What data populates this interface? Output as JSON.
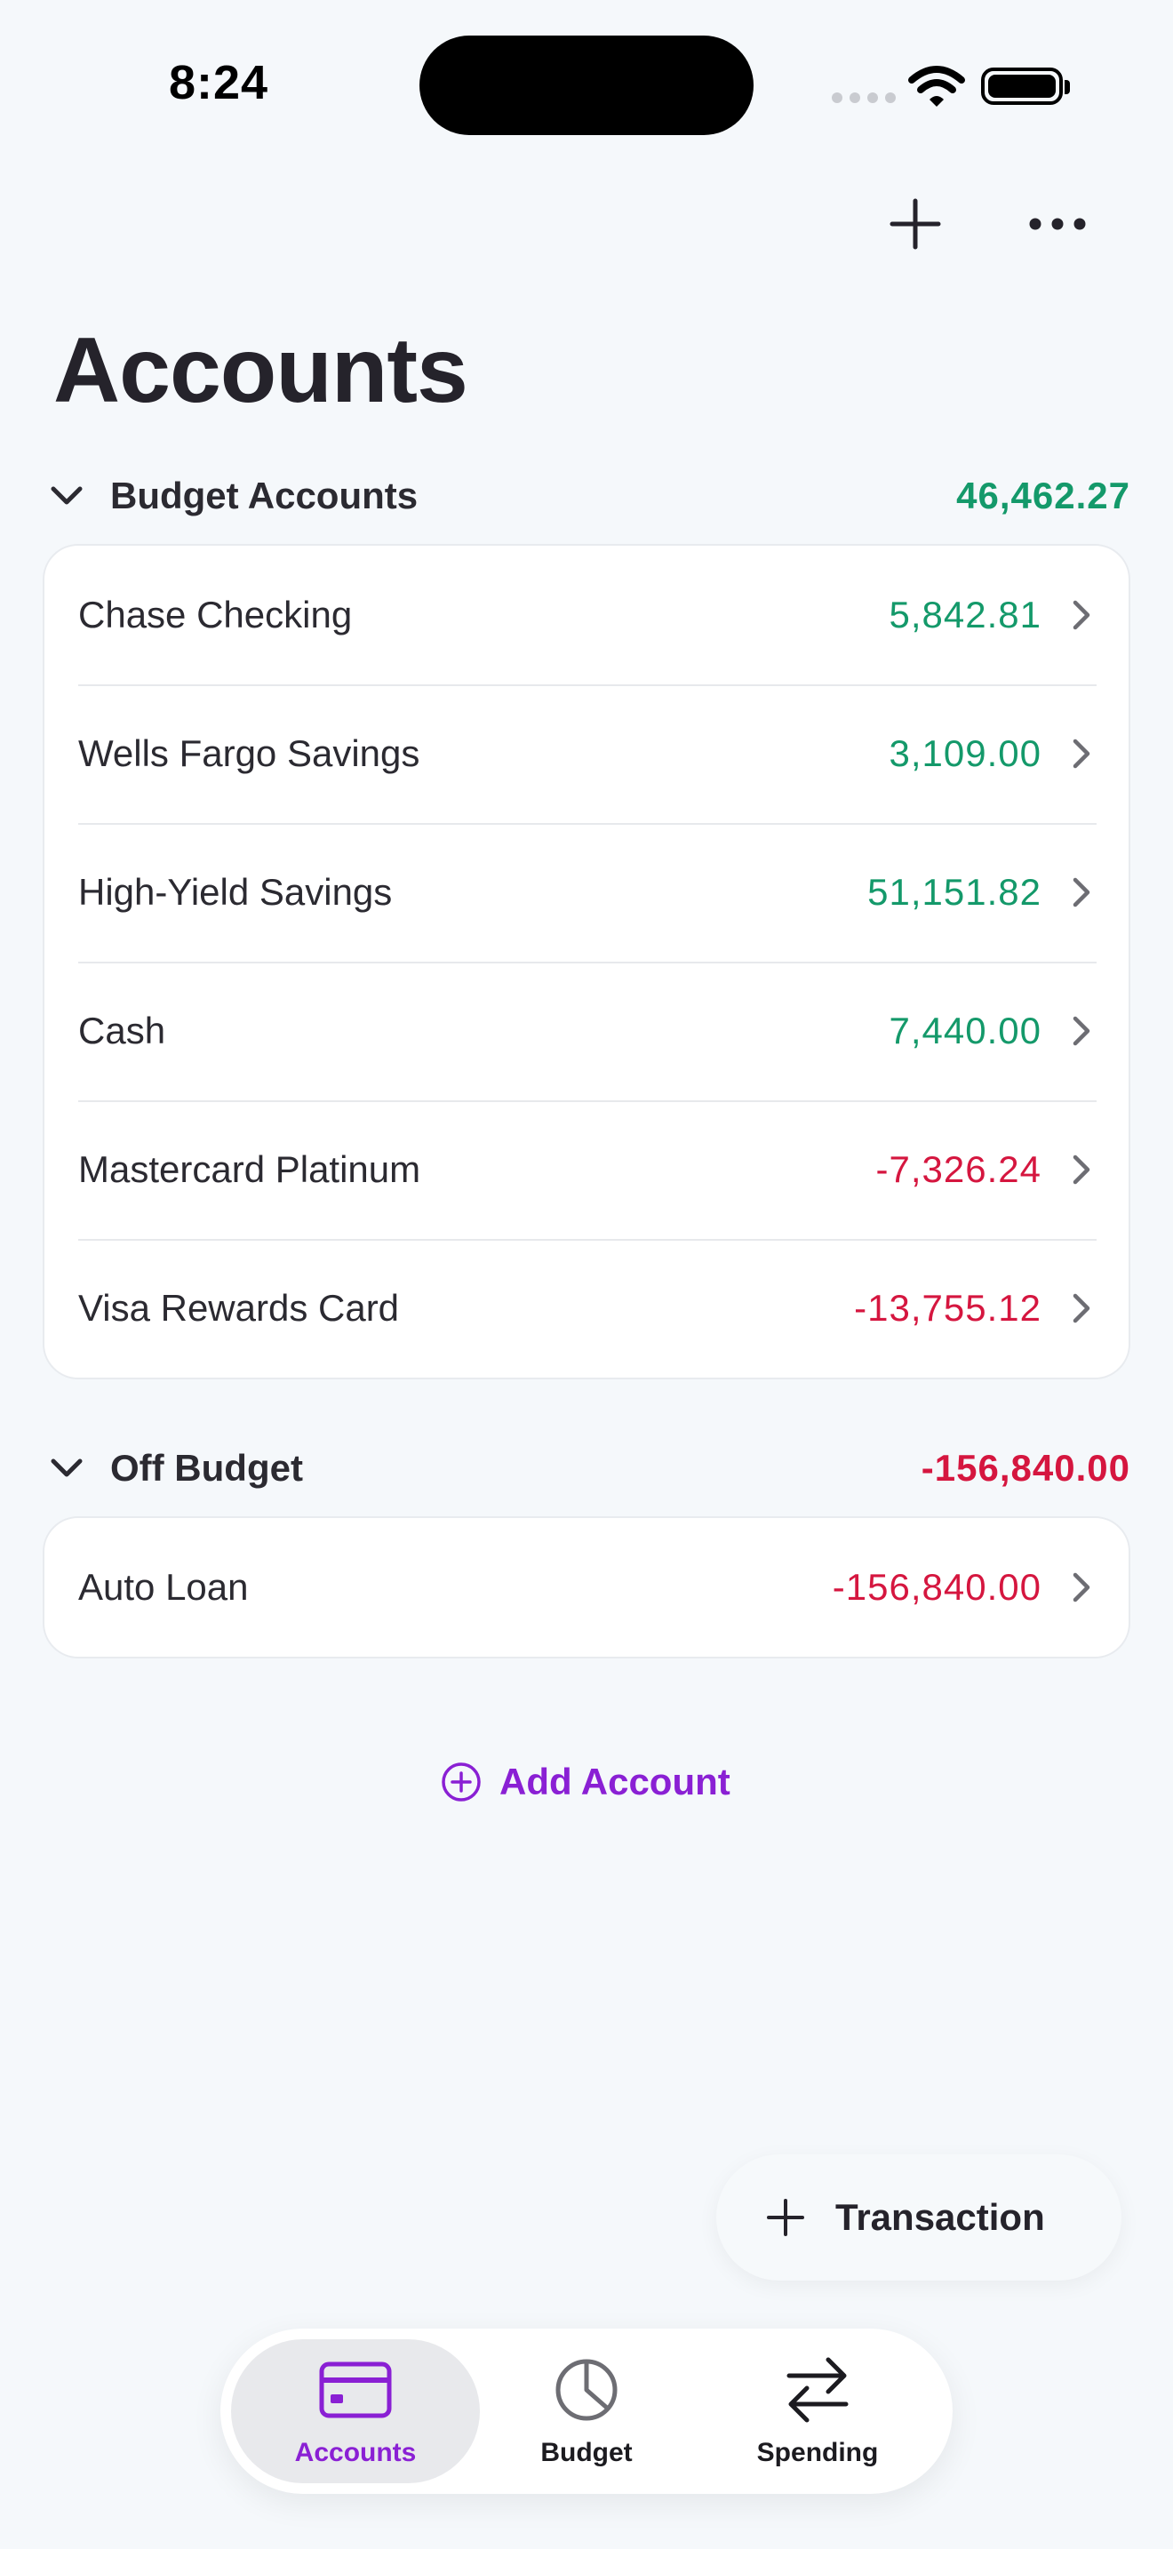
{
  "status": {
    "time": "8:24"
  },
  "header": {
    "title": "Accounts"
  },
  "sections": [
    {
      "title": "Budget Accounts",
      "total": "46,462.27",
      "accounts": [
        {
          "name": "Chase Checking",
          "amount": "5,842.81"
        },
        {
          "name": "Wells Fargo Savings",
          "amount": "3,109.00"
        },
        {
          "name": "High-Yield Savings",
          "amount": "51,151.82"
        },
        {
          "name": "Cash",
          "amount": "7,440.00"
        },
        {
          "name": "Mastercard Platinum",
          "amount": "-7,326.24"
        },
        {
          "name": "Visa Rewards Card",
          "amount": "-13,755.12"
        }
      ]
    },
    {
      "title": "Off Budget",
      "total": "-156,840.00",
      "accounts": [
        {
          "name": "Auto Loan",
          "amount": "-156,840.00"
        }
      ]
    }
  ],
  "add_account_label": "Add Account",
  "transaction_label": "Transaction",
  "tabs": [
    {
      "label": "Accounts",
      "icon": "credit-card-icon",
      "active": true
    },
    {
      "label": "Budget",
      "icon": "pie-chart-icon",
      "active": false
    },
    {
      "label": "Spending",
      "icon": "arrows-swap-icon",
      "active": false
    }
  ],
  "colors": {
    "positive": "#14996a",
    "negative": "#d5163f",
    "accent": "#8a20d4",
    "background": "#f5f8fb"
  }
}
